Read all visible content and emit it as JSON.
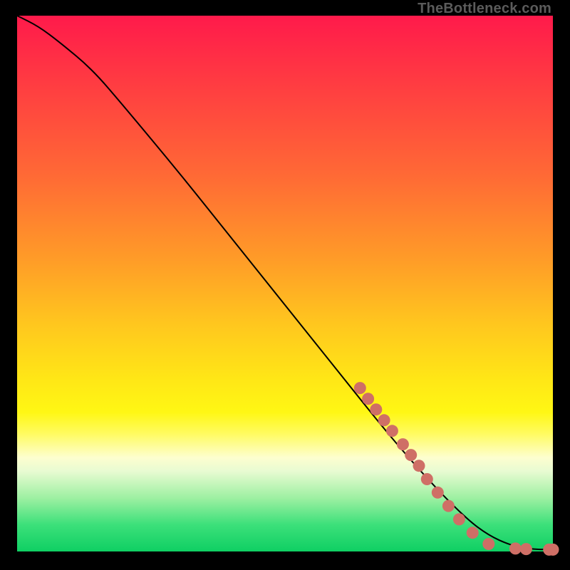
{
  "watermark": "TheBottleneck.com",
  "colors": {
    "dot": "#cf6f66",
    "line": "#000000",
    "background_black": "#000000"
  },
  "chart_data": {
    "type": "line",
    "title": "",
    "xlabel": "",
    "ylabel": "",
    "xlim": [
      0,
      100
    ],
    "ylim": [
      0,
      100
    ],
    "grid": false,
    "legend": false,
    "series": [
      {
        "name": "bottleneck-curve",
        "x": [
          0,
          4,
          8,
          14,
          20,
          30,
          40,
          50,
          60,
          70,
          78,
          84,
          88,
          92,
          95,
          97,
          100
        ],
        "y": [
          100,
          98,
          95,
          90,
          83,
          71,
          58.5,
          46,
          33.5,
          21,
          12,
          6,
          3,
          1.2,
          0.6,
          0.4,
          0.35
        ],
        "comment": "y is bottleneck % (100 top, 0 bottom); x is relative performance axis; values estimated from the rendered curve — no axis ticks are shown in the image."
      }
    ],
    "dots": {
      "name": "highlighted-points",
      "color": "#cf6f66",
      "points": [
        {
          "x": 64,
          "y": 30.5
        },
        {
          "x": 65.5,
          "y": 28.5
        },
        {
          "x": 67,
          "y": 26.5
        },
        {
          "x": 68.5,
          "y": 24.5
        },
        {
          "x": 70,
          "y": 22.5
        },
        {
          "x": 72,
          "y": 20
        },
        {
          "x": 73.5,
          "y": 18
        },
        {
          "x": 75,
          "y": 16
        },
        {
          "x": 76.5,
          "y": 13.5
        },
        {
          "x": 78.5,
          "y": 11
        },
        {
          "x": 80.5,
          "y": 8.5
        },
        {
          "x": 82.5,
          "y": 6
        },
        {
          "x": 85,
          "y": 3.5
        },
        {
          "x": 88,
          "y": 1.4
        },
        {
          "x": 93,
          "y": 0.55
        },
        {
          "x": 95,
          "y": 0.45
        },
        {
          "x": 99.3,
          "y": 0.35
        },
        {
          "x": 100,
          "y": 0.35
        }
      ],
      "comment": "coral dots clustered on the lower-right stretch of the curve; coordinates in same 0–100 space as the series."
    }
  }
}
